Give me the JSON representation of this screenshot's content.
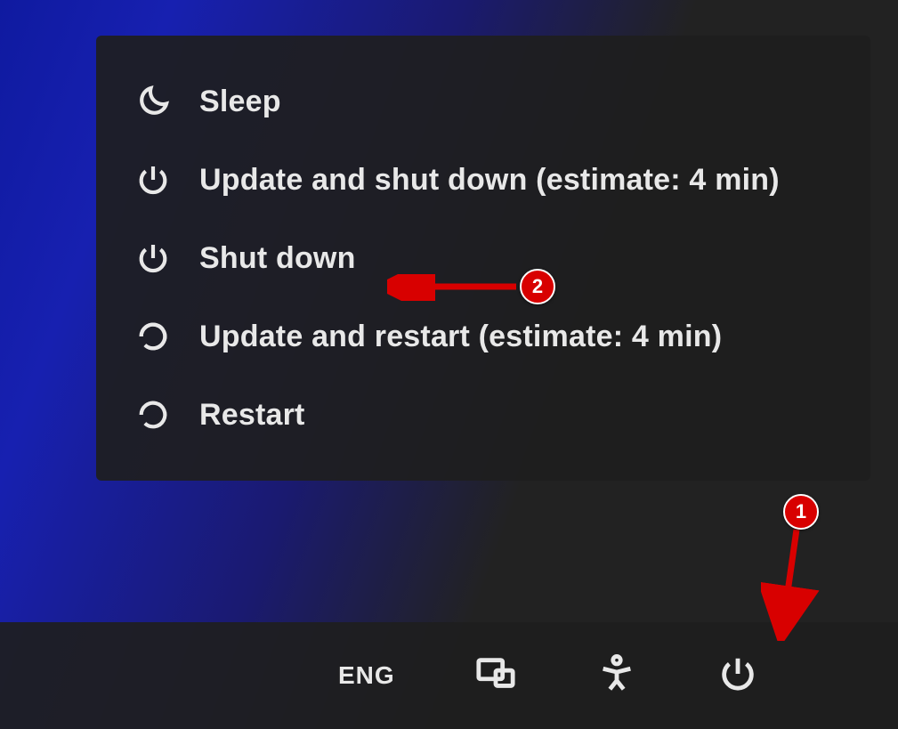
{
  "power_menu": {
    "items": [
      {
        "icon": "moon",
        "label": "Sleep"
      },
      {
        "icon": "power",
        "label": "Update and shut down (estimate: 4 min)"
      },
      {
        "icon": "power",
        "label": "Shut down"
      },
      {
        "icon": "restart",
        "label": "Update and restart (estimate: 4 min)"
      },
      {
        "icon": "restart",
        "label": "Restart"
      }
    ]
  },
  "taskbar": {
    "language_label": "ENG"
  },
  "annotations": {
    "badge1": "1",
    "badge2": "2"
  }
}
